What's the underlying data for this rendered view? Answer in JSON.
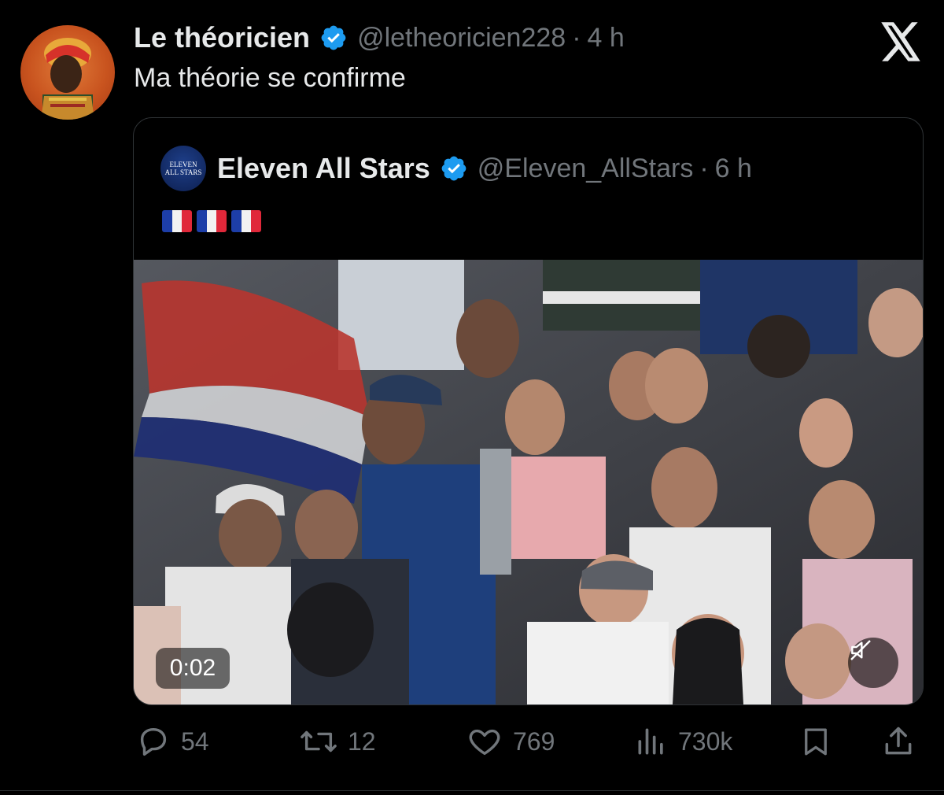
{
  "tweet": {
    "author_name": "Le théoricien",
    "handle": "@letheoricien228",
    "separator": "·",
    "time": "4 h",
    "text": "Ma théorie se confirme",
    "verified_color": "#1d9bf0"
  },
  "quote": {
    "author_name": "Eleven All Stars",
    "handle": "@Eleven_AllStars",
    "separator": "·",
    "time": "6 h",
    "avatar_text_line1": "ELEVEN",
    "avatar_text_line2": "ALL STARS",
    "flags": [
      "🇫🇷",
      "🇫🇷",
      "🇫🇷"
    ],
    "video": {
      "duration": "0:02",
      "muted": true
    }
  },
  "actions": {
    "replies": "54",
    "reposts": "12",
    "likes": "769",
    "views": "730k"
  },
  "icons": {
    "x_logo": "x-logo-icon",
    "verified": "verified-badge-icon",
    "reply": "reply-icon",
    "repost": "repost-icon",
    "like": "heart-icon",
    "views": "views-icon",
    "bookmark": "bookmark-icon",
    "share": "share-icon",
    "mute": "muted-speaker-icon"
  }
}
